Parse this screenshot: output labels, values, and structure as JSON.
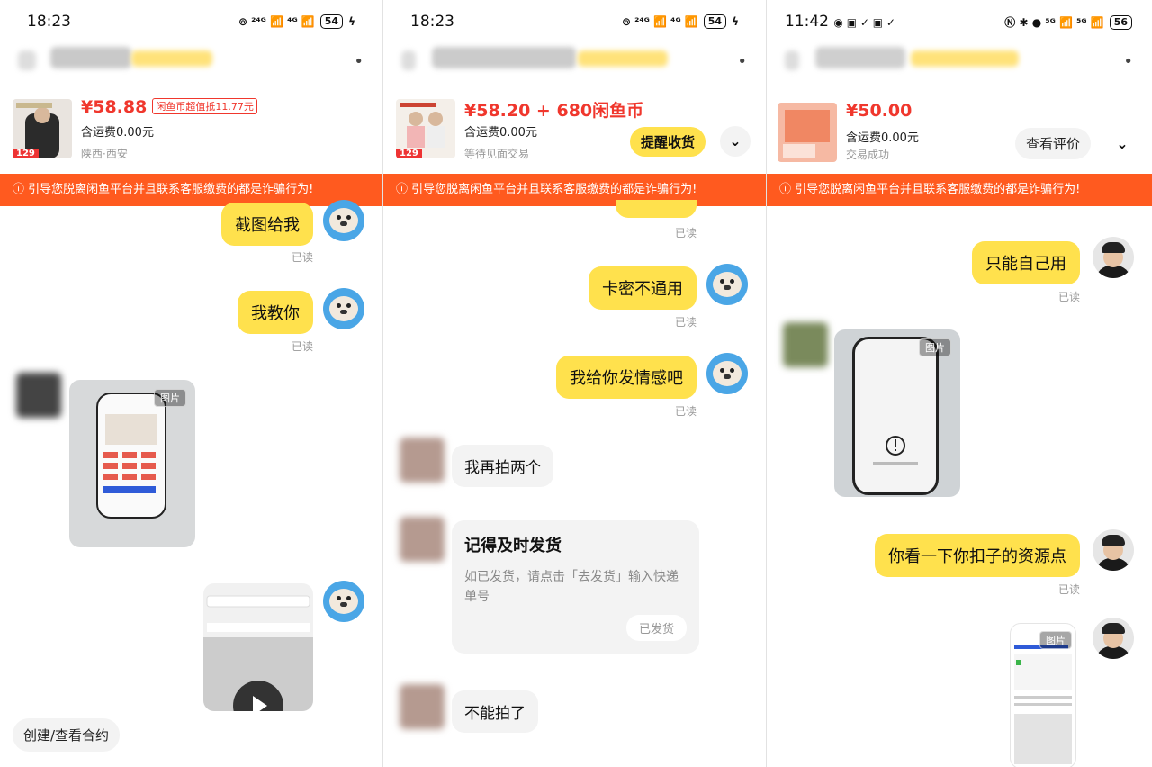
{
  "panels": [
    {
      "status_time": "18:23",
      "status_icons": "⊚ ²⁴ᴳ 📶 ⁴ᴳ 📶",
      "battery": "54",
      "product": {
        "price": "¥58.88",
        "price_tag": "闲鱼币超值抵11.77元",
        "shipping": "含运费0.00元",
        "location": "陕西·西安",
        "badge": "129"
      },
      "warning": "ⓘ 引导您脱离闲鱼平台并且联系客服缴费的都是诈骗行为!",
      "messages": [
        {
          "text": "截图给我",
          "read": "已读"
        },
        {
          "text": "我教你",
          "read": "已读"
        }
      ],
      "image_tag": "图片",
      "contract_button": "创建/查看合约"
    },
    {
      "status_time": "18:23",
      "status_icons": "⊚ ²⁴ᴳ 📶 ⁴ᴳ 📶",
      "battery": "54",
      "product": {
        "price": "¥58.20 + 680闲鱼币",
        "shipping": "含运费0.00元",
        "location": "等待见面交易",
        "badge": "129"
      },
      "action_button": "提醒收货",
      "warning": "ⓘ 引导您脱离闲鱼平台并且联系客服缴费的都是诈骗行为!",
      "messages": [
        {
          "text": "",
          "read": "已读"
        },
        {
          "text": "卡密不通用",
          "read": "已读"
        },
        {
          "text": "我给你发情感吧",
          "read": "已读"
        }
      ],
      "incoming": [
        {
          "text": "我再拍两个"
        },
        {
          "text": "不能拍了"
        }
      ],
      "card": {
        "title": "记得及时发货",
        "body": "如已发货，请点击「去发货」输入快递单号",
        "button": "已发货"
      }
    },
    {
      "status_time": "11:42",
      "status_icons": "◉ ▣ ✓ ▣ ✓",
      "status_icons_right": "Ⓝ ✱ ● ⁵ᴳ 📶 ⁵ᴳ 📶",
      "battery": "56",
      "product": {
        "price": "¥50.00",
        "shipping": "含运费0.00元",
        "location": "交易成功"
      },
      "action_button": "查看评价",
      "warning": "ⓘ 引导您脱离闲鱼平台并且联系客服缴费的都是诈骗行为!",
      "messages": [
        {
          "text": "只能自己用",
          "read": "已读"
        },
        {
          "text": "你看一下你扣子的资源点",
          "read": "已读"
        }
      ],
      "image_tag": "图片",
      "image_tag_2": "图片"
    }
  ],
  "chevron": "⌄",
  "more_dots": "•"
}
